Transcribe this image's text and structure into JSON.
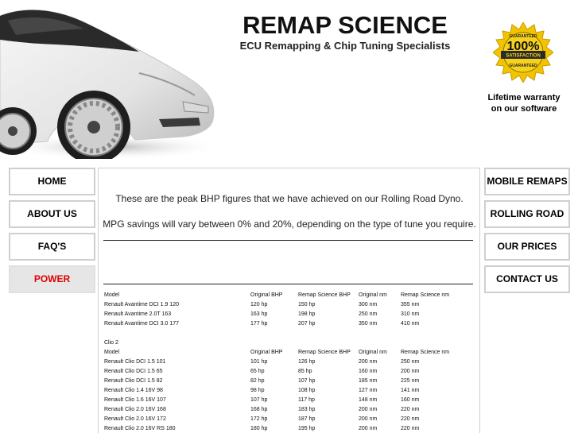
{
  "brand": {
    "title": "REMAP SCIENCE",
    "subtitle": "ECU Remapping & Chip Tuning Specialists"
  },
  "badge": {
    "top_text": "GUARANTEED",
    "percent": "100%",
    "label": "SATISFACTION",
    "bottom_text": "GUARANTEED",
    "color": "#f2c400"
  },
  "warranty": {
    "line1": "Lifetime warranty",
    "line2": "on our software"
  },
  "nav_left": [
    {
      "label": "HOME",
      "active": false
    },
    {
      "label": "ABOUT US",
      "active": false
    },
    {
      "label": "FAQ'S",
      "active": false
    },
    {
      "label": "POWER",
      "active": true
    }
  ],
  "nav_right": [
    {
      "label": "MOBILE REMAPS"
    },
    {
      "label": "ROLLING ROAD"
    },
    {
      "label": "OUR PRICES"
    },
    {
      "label": "CONTACT US"
    }
  ],
  "intro": {
    "line1": "These are the peak BHP figures that we have achieved on our Rolling Road Dyno.",
    "line2": "MPG savings will vary between 0% and 20%, depending on the type of tune you require."
  },
  "table_headers": [
    "Model",
    "Original BHP",
    "Remap Science BHP",
    "Original nm",
    "Remap Science nm"
  ],
  "avantime_rows": [
    [
      "Renault Avantime DCI 1.9 120",
      "120 hp",
      "150 hp",
      "300 nm",
      "355 nm"
    ],
    [
      "Renault Avantime 2.0T 163",
      "163 hp",
      "198 hp",
      "250 nm",
      "310 nm"
    ],
    [
      "Renault Avantime DCI 3.0 177",
      "177 hp",
      "207 hp",
      "350 nm",
      "410 nm"
    ]
  ],
  "clio_title": "Clio 2",
  "clio_rows": [
    [
      "Renault Clio DCI 1.5 101",
      "101 hp",
      "126 hp",
      "200 nm",
      "250 nm"
    ],
    [
      "Renault Clio DCI 1.5 65",
      "65 hp",
      "85 hp",
      "160 nm",
      "200 nm"
    ],
    [
      "Renault Clio DCI 1.5 82",
      "82 hp",
      "107 hp",
      "185 nm",
      "225 nm"
    ],
    [
      "Renault Clio 1.4 16V 98",
      "98 hp",
      "108 hp",
      "127 nm",
      "141 nm"
    ],
    [
      "Renault Clio 1.6 16V 107",
      "107 hp",
      "117 hp",
      "148 nm",
      "160 nm"
    ],
    [
      "Renault Clio 2.0 16V 168",
      "168 hp",
      "183 hp",
      "200 nm",
      "220 nm"
    ],
    [
      "Renault Clio 2.0 16V 172",
      "172 hp",
      "187 hp",
      "200 nm",
      "220 nm"
    ],
    [
      "Renault Clio 2.0 16V RS 180",
      "180 hp",
      "195 hp",
      "200 nm",
      "220 nm"
    ]
  ]
}
